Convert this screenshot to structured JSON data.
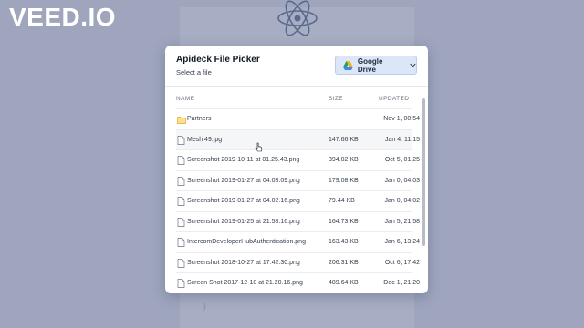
{
  "watermark": "VEED.IO",
  "background": {
    "code_line_a": "— — — — — —",
    "code_line_b": "}"
  },
  "picker": {
    "title": "Apideck File Picker",
    "subtitle": "Select a file",
    "source_button": {
      "label": "Google Drive",
      "icon": "google-drive-icon",
      "dropdown_icon": "chevron-down-icon"
    },
    "columns": {
      "name": "NAME",
      "size": "SIZE",
      "updated": "UPDATED"
    },
    "files": [
      {
        "name": "Partners",
        "size": "",
        "updated": "Nov 1, 00:54",
        "type": "folder"
      },
      {
        "name": "Mesh 49.jpg",
        "size": "147.66 KB",
        "updated": "Jan 4, 11:15",
        "type": "file"
      },
      {
        "name": "Screenshot 2019-10-11 at 01.25.43.png",
        "size": "394.02 KB",
        "updated": "Oct 5, 01:25",
        "type": "file"
      },
      {
        "name": "Screenshot 2019-01-27 at 04.03.09.png",
        "size": "179.08 KB",
        "updated": "Jan 0, 04:03",
        "type": "file"
      },
      {
        "name": "Screenshot 2019-01-27 at 04.02.16.png",
        "size": "79.44 KB",
        "updated": "Jan 0, 04:02",
        "type": "file"
      },
      {
        "name": "Screenshot 2019-01-25 at 21.58.16.png",
        "size": "164.73 KB",
        "updated": "Jan 5, 21:58",
        "type": "file"
      },
      {
        "name": "IntercomDeveloperHubAuthentication.png",
        "size": "163.43 KB",
        "updated": "Jan 6, 13:24",
        "type": "file"
      },
      {
        "name": "Screenshot 2018-10-27 at 17.42.30.png",
        "size": "206.31 KB",
        "updated": "Oct 6, 17:42",
        "type": "file"
      },
      {
        "name": "Screen Shot 2017-12-18 at 21.20.16.png",
        "size": "489.64 KB",
        "updated": "Dec 1, 21:20",
        "type": "file"
      }
    ]
  },
  "colors": {
    "backdrop": "#9ea5bd",
    "button_bg": "#dbe7f8",
    "folder": "#f4c542"
  }
}
